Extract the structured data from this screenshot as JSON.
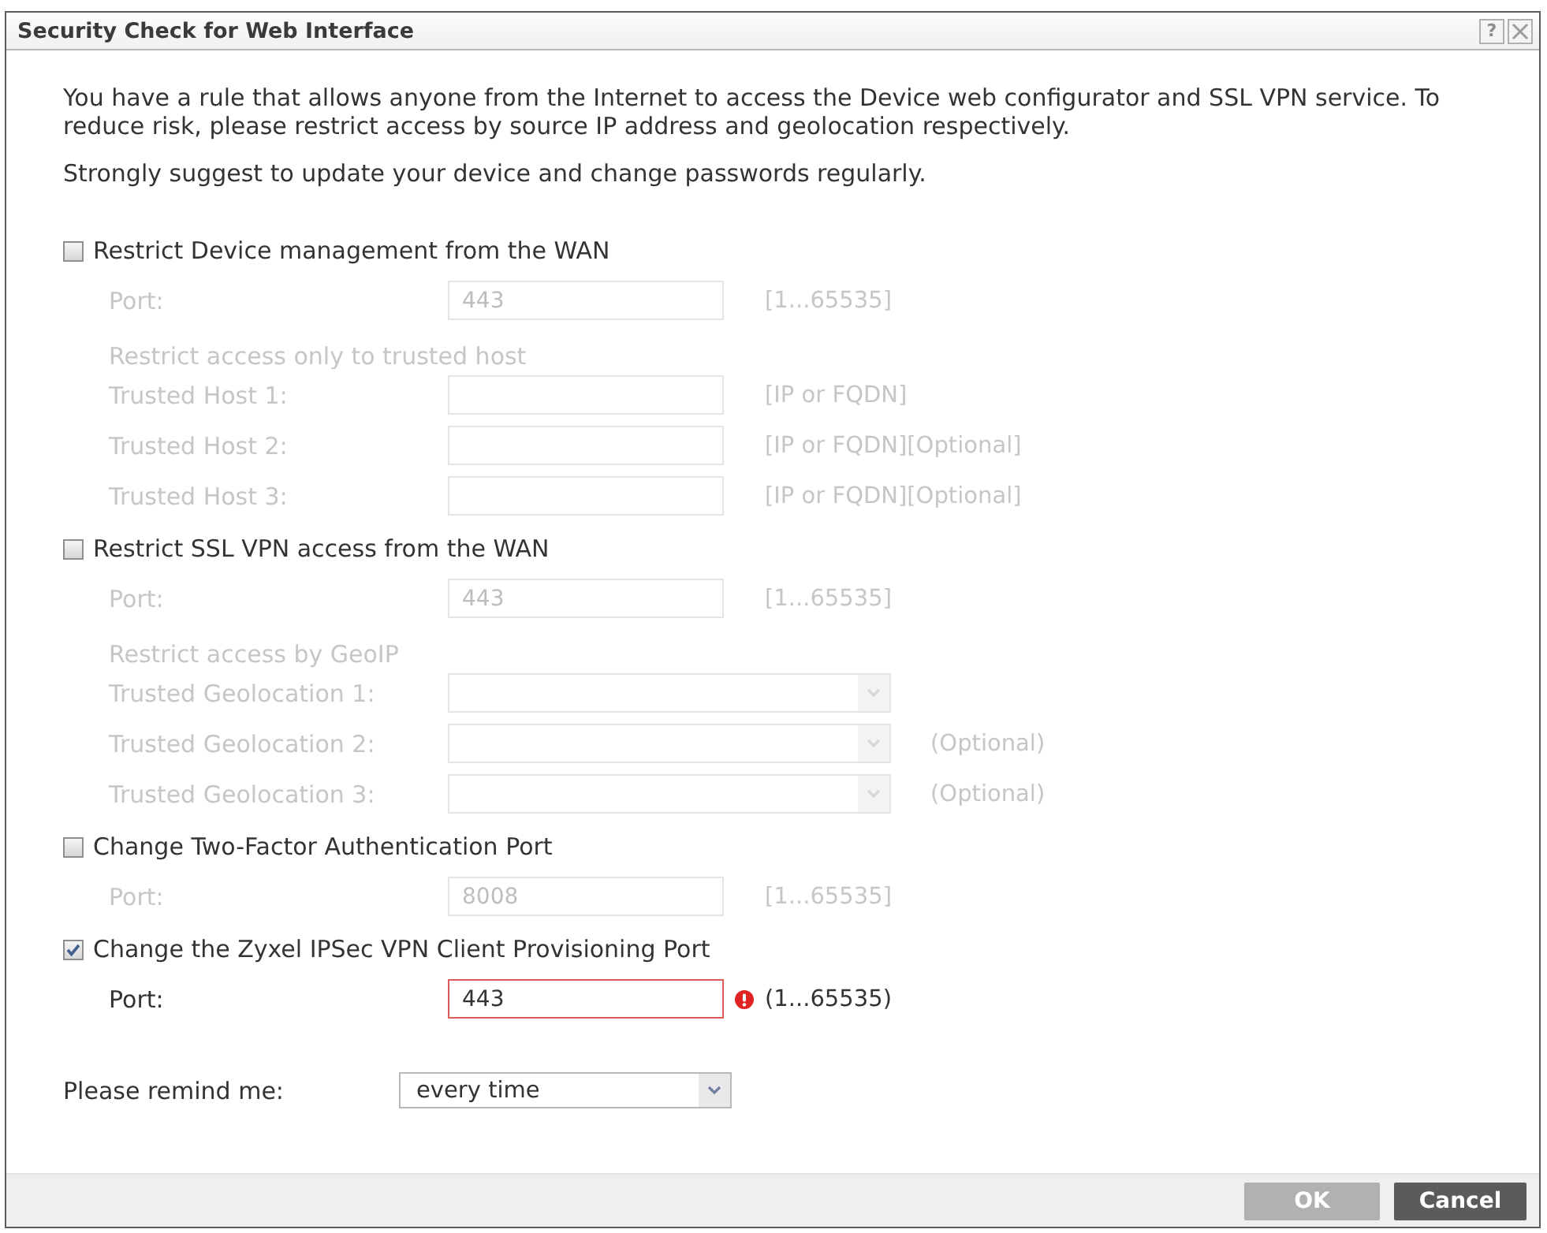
{
  "dialog": {
    "title": "Security Check for Web Interface",
    "help_button": "?"
  },
  "message": [
    "You have a rule that allows anyone from the Internet to access the Device web configurator and SSL VPN service. To reduce risk, please restrict access by source IP address and geolocation respectively.",
    "Strongly suggest to update your device and change passwords regularly."
  ],
  "sections": [
    {
      "label": "Restrict Device management from the WAN",
      "checked": false,
      "rows": [
        {
          "kind": "input",
          "label": "Port:",
          "value": "443",
          "hint": "[1...65535]",
          "error": false
        },
        {
          "kind": "heading",
          "label": "Restrict access only to trusted host"
        },
        {
          "kind": "input",
          "label": "Trusted Host 1:",
          "hint": "[IP or FQDN]",
          "error": false
        },
        {
          "kind": "input",
          "label": "Trusted Host 2:",
          "hint": "[IP or FQDN][Optional]",
          "error": false
        },
        {
          "kind": "input",
          "label": "Trusted Host 3:",
          "hint": "[IP or FQDN][Optional]",
          "error": false
        }
      ]
    },
    {
      "label": "Restrict SSL VPN access from the WAN",
      "checked": false,
      "rows": [
        {
          "kind": "input",
          "label": "Port:",
          "value": "443",
          "hint": "[1...65535]",
          "error": false
        },
        {
          "kind": "heading",
          "label": "Restrict access by GeoIP"
        },
        {
          "kind": "select",
          "label": "Trusted Geolocation 1:",
          "error": false
        },
        {
          "kind": "select",
          "label": "Trusted Geolocation 2:",
          "hint": "(Optional)",
          "error": false
        },
        {
          "kind": "select",
          "label": "Trusted Geolocation 3:",
          "hint": "(Optional)",
          "error": false
        }
      ]
    },
    {
      "label": "Change Two-Factor Authentication Port",
      "checked": false,
      "rows": [
        {
          "kind": "input",
          "label": "Port:",
          "value": "8008",
          "hint": "[1...65535]",
          "error": false
        }
      ]
    },
    {
      "label": "Change the Zyxel IPSec VPN Client Provisioning Port",
      "checked": true,
      "rows": [
        {
          "kind": "input",
          "label": "Port:",
          "value": "443",
          "hint": "(1...65535)",
          "error": true
        }
      ]
    }
  ],
  "reminder": {
    "label": "Please remind me:",
    "value": "every time"
  },
  "buttons": [
    {
      "label": "OK",
      "disabled": true
    },
    {
      "label": "Cancel",
      "disabled": false
    }
  ]
}
